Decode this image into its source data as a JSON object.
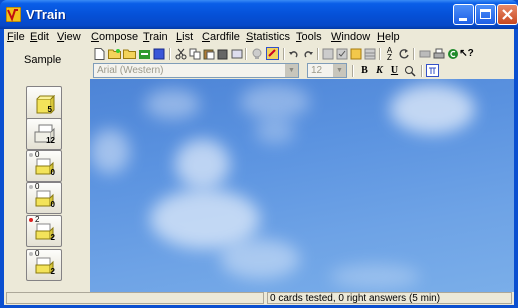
{
  "window": {
    "title": "VTrain"
  },
  "menu": [
    {
      "label": "File",
      "u": "F",
      "rest": "ile"
    },
    {
      "label": "Edit",
      "u": "E",
      "rest": "dit"
    },
    {
      "label": "View",
      "u": "V",
      "rest": "iew"
    },
    {
      "label": "Compose",
      "u": "C",
      "rest": "ompose"
    },
    {
      "label": "Train",
      "u": "T",
      "rest": "rain"
    },
    {
      "label": "List",
      "u": "L",
      "rest": "ist"
    },
    {
      "label": "Cardfile",
      "u": "C",
      "rest": "ardfile"
    },
    {
      "label": "Statistics",
      "u": "S",
      "rest": "tatistics"
    },
    {
      "label": "Tools",
      "u": "T",
      "rest": "ools"
    },
    {
      "label": "Window",
      "u": "W",
      "rest": "indow"
    },
    {
      "label": "Help",
      "u": "H",
      "rest": "elp"
    }
  ],
  "panel": {
    "label": "Sample"
  },
  "format": {
    "font": "Arial (Western)",
    "size": "12",
    "bold": "B",
    "italic": "K",
    "underline": "U"
  },
  "boxes": [
    {
      "top_count": "",
      "count": "5",
      "dot": ""
    },
    {
      "top_count": "",
      "count": "12",
      "dot": ""
    },
    {
      "top_count": "0",
      "count": "0",
      "dot": "gray"
    },
    {
      "top_count": "0",
      "count": "0",
      "dot": "gray"
    },
    {
      "top_count": "2",
      "count": "2",
      "dot": "red"
    },
    {
      "top_count": "0",
      "count": "2",
      "dot": "gray"
    }
  ],
  "status": {
    "text": "0 cards tested, 0 right answers (5 min)"
  },
  "colors": {
    "titlebar": "#0551d8",
    "sky": "#5b93e0",
    "face": "#ece9d8",
    "box_yellow": "#f5e65a"
  }
}
